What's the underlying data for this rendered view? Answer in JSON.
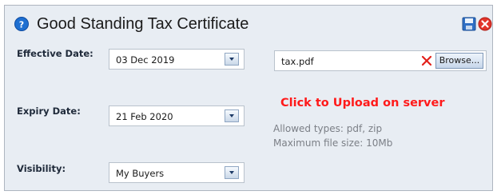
{
  "dialog": {
    "title": "Good Standing Tax Certificate"
  },
  "icons": {
    "help": "help-icon",
    "save": "save-icon",
    "close": "close-icon",
    "clear": "clear-icon",
    "dropdown": "chevron-down-icon"
  },
  "colors": {
    "accent_red": "#ff1a1a",
    "help_blue": "#1e6fd1",
    "panel_bg": "#e8edf3"
  },
  "fields": {
    "effective_date": {
      "label": "Effective Date:",
      "value": "03 Dec 2019"
    },
    "expiry_date": {
      "label": "Expiry Date:",
      "value": "21 Feb 2020"
    },
    "visibility": {
      "label": "Visibility:",
      "value": "My Buyers"
    }
  },
  "upload": {
    "file_name": "tax.pdf",
    "browse_label": "Browse...",
    "upload_link": "Click to Upload on server",
    "allowed_types": "Allowed types: pdf, zip",
    "max_size": "Maximum file size: 10Mb"
  }
}
